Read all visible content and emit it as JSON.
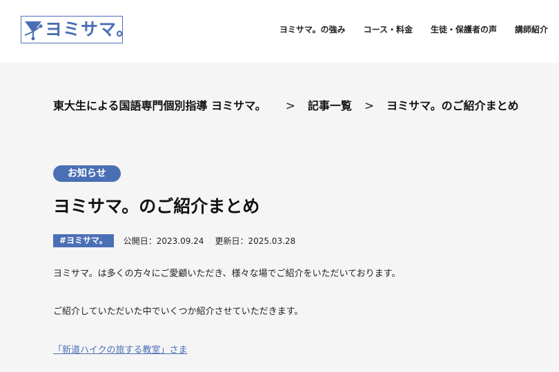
{
  "header": {
    "logo_text": "ヨミサマ。",
    "nav": [
      {
        "label": "ヨミサマ。の強み"
      },
      {
        "label": "コース・料金"
      },
      {
        "label": "生徒・保護者の声"
      },
      {
        "label": "講師紹介"
      }
    ]
  },
  "breadcrumb": {
    "items": [
      "東大生による国語専門個別指導 ヨミサマ。",
      "記事一覧",
      "ヨミサマ。のご紹介まとめ"
    ],
    "separator": ">"
  },
  "article": {
    "category": "お知らせ",
    "title": "ヨミサマ。のご紹介まとめ",
    "tag": "#ヨミサマ。",
    "published_label": "公開日：",
    "published": "2023.09.24",
    "updated_label": "更新日：",
    "updated": "2025.03.28",
    "paragraphs": [
      "ヨミサマ。は多くの方々にご愛顧いただき、様々な場でご紹介をいただいております。",
      "ご紹介していただいた中でいくつか紹介させていただきます。"
    ],
    "link_text": "「新道ハイクの旅する教室」さま"
  },
  "colors": {
    "brand": "#4a6fb5",
    "page_background": "#f5f5f5",
    "header_background": "#ffffff"
  }
}
